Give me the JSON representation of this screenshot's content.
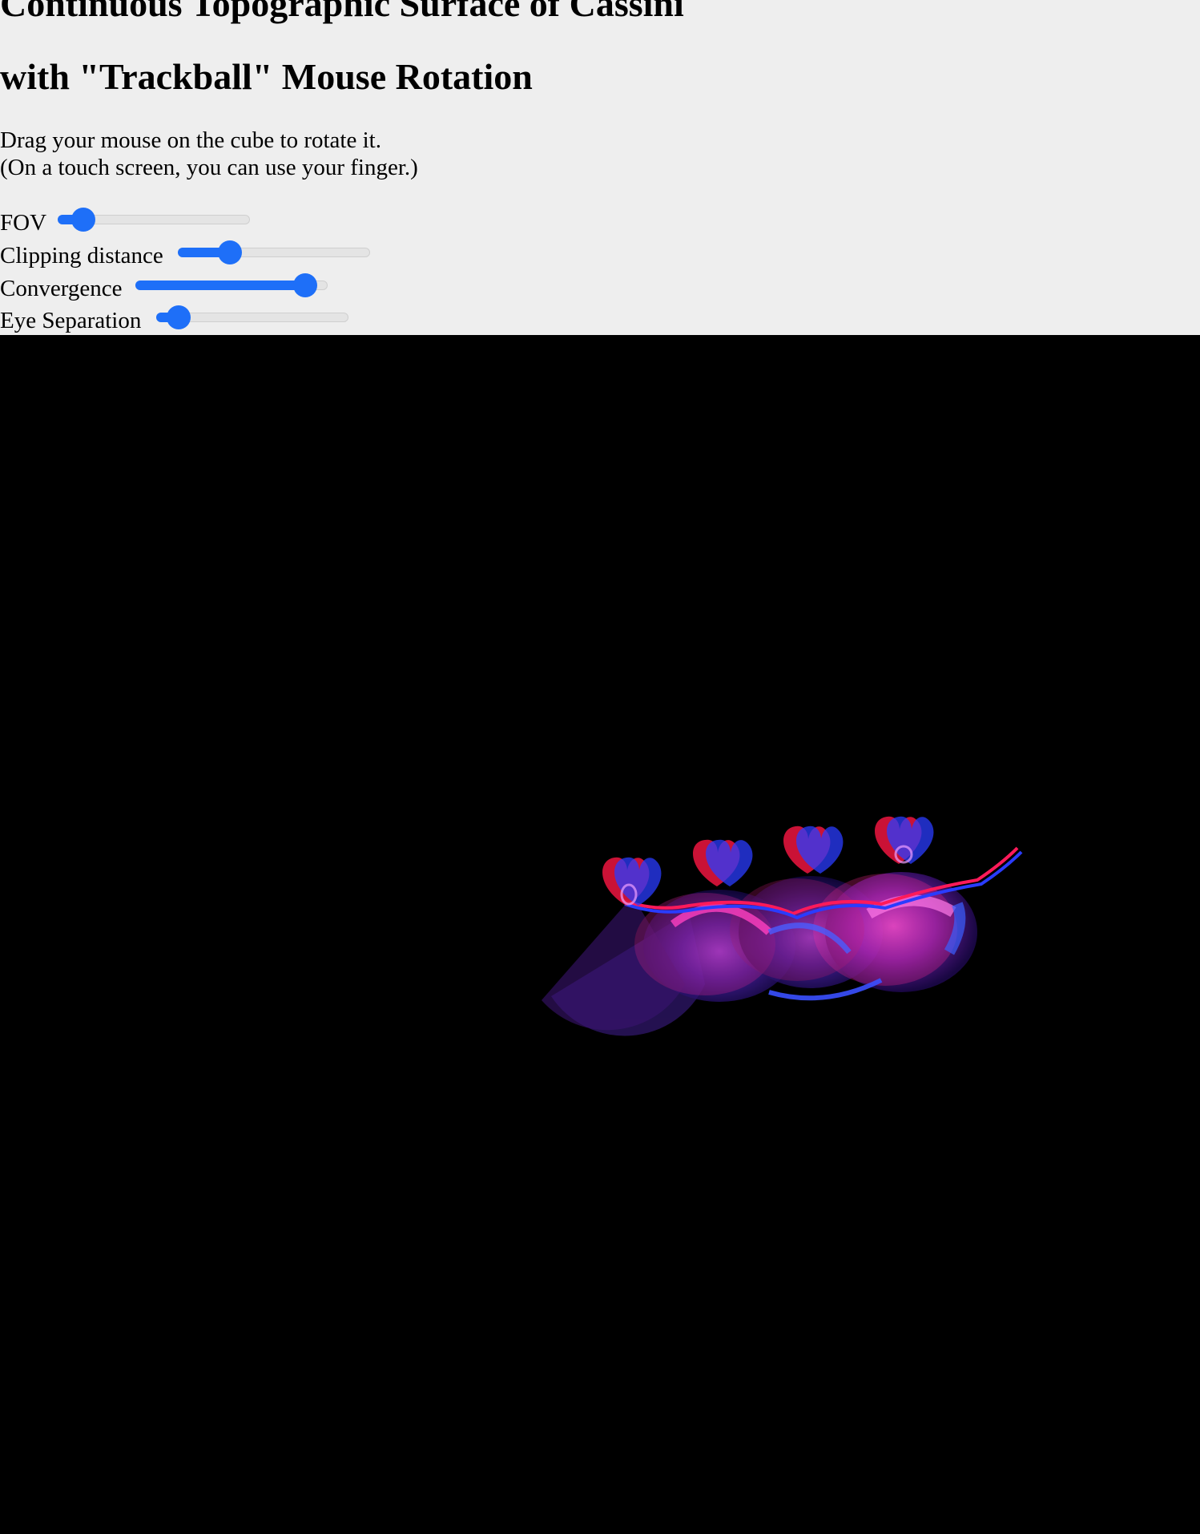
{
  "header": {
    "title_line1": "Continuous Topographic Surface of Cassini",
    "title_line2": "with \"Trackball\" Mouse Rotation",
    "instruction_line1": "Drag your mouse on the cube to rotate it.",
    "instruction_line2": "(On a touch screen, you can use your finger.)"
  },
  "controls": {
    "fov": {
      "label": "FOV",
      "fraction": 0.08
    },
    "clipping_distance": {
      "label": "Clipping distance",
      "fraction": 0.24
    },
    "convergence": {
      "label": "Convergence",
      "fraction": 0.94
    },
    "eye_separation": {
      "label": "Eye Separation",
      "fraction": 0.06
    }
  },
  "colors": {
    "accent": "#1e6ff8",
    "page_background": "#eeeeee",
    "canvas_background": "#000000",
    "anaglyph_red": "#ff1a3c",
    "anaglyph_blue": "#2a3cff"
  }
}
